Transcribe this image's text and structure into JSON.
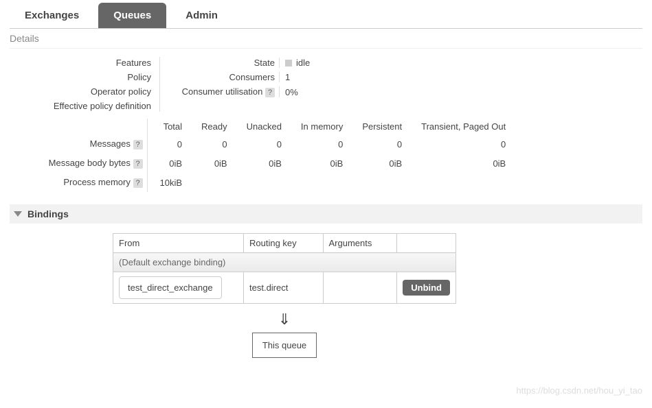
{
  "tabs": {
    "exchanges": "Exchanges",
    "queues": "Queues",
    "admin": "Admin"
  },
  "section_details": "Details",
  "features": {
    "left": {
      "features": "Features",
      "policy": "Policy",
      "operator_policy": "Operator policy",
      "effective_policy": "Effective policy definition"
    },
    "right": {
      "state_label": "State",
      "state_value": "idle",
      "consumers_label": "Consumers",
      "consumers_value": "1",
      "cu_label": "Consumer utilisation",
      "cu_value": "0%"
    }
  },
  "matrix": {
    "cols": {
      "total": "Total",
      "ready": "Ready",
      "unacked": "Unacked",
      "in_memory": "In memory",
      "persistent": "Persistent",
      "transient": "Transient, Paged Out"
    },
    "rows": {
      "messages": {
        "label": "Messages",
        "values": {
          "total": "0",
          "ready": "0",
          "unacked": "0",
          "in_memory": "0",
          "persistent": "0",
          "transient": "0"
        }
      },
      "body_bytes": {
        "label": "Message body bytes",
        "values": {
          "total": "0iB",
          "ready": "0iB",
          "unacked": "0iB",
          "in_memory": "0iB",
          "persistent": "0iB",
          "transient": "0iB"
        }
      },
      "process_memory": {
        "label": "Process memory",
        "value": "10kiB"
      }
    }
  },
  "bindings": {
    "title": "Bindings",
    "headers": {
      "from": "From",
      "routing_key": "Routing key",
      "arguments": "Arguments",
      "action": ""
    },
    "default_row": "(Default exchange binding)",
    "rows": [
      {
        "from": "test_direct_exchange",
        "routing_key": "test.direct",
        "arguments": "",
        "action": "Unbind"
      }
    ],
    "flow": {
      "queue": "This queue"
    }
  },
  "help_glyph": "?",
  "watermark": "https://blog.csdn.net/hou_yi_tao"
}
